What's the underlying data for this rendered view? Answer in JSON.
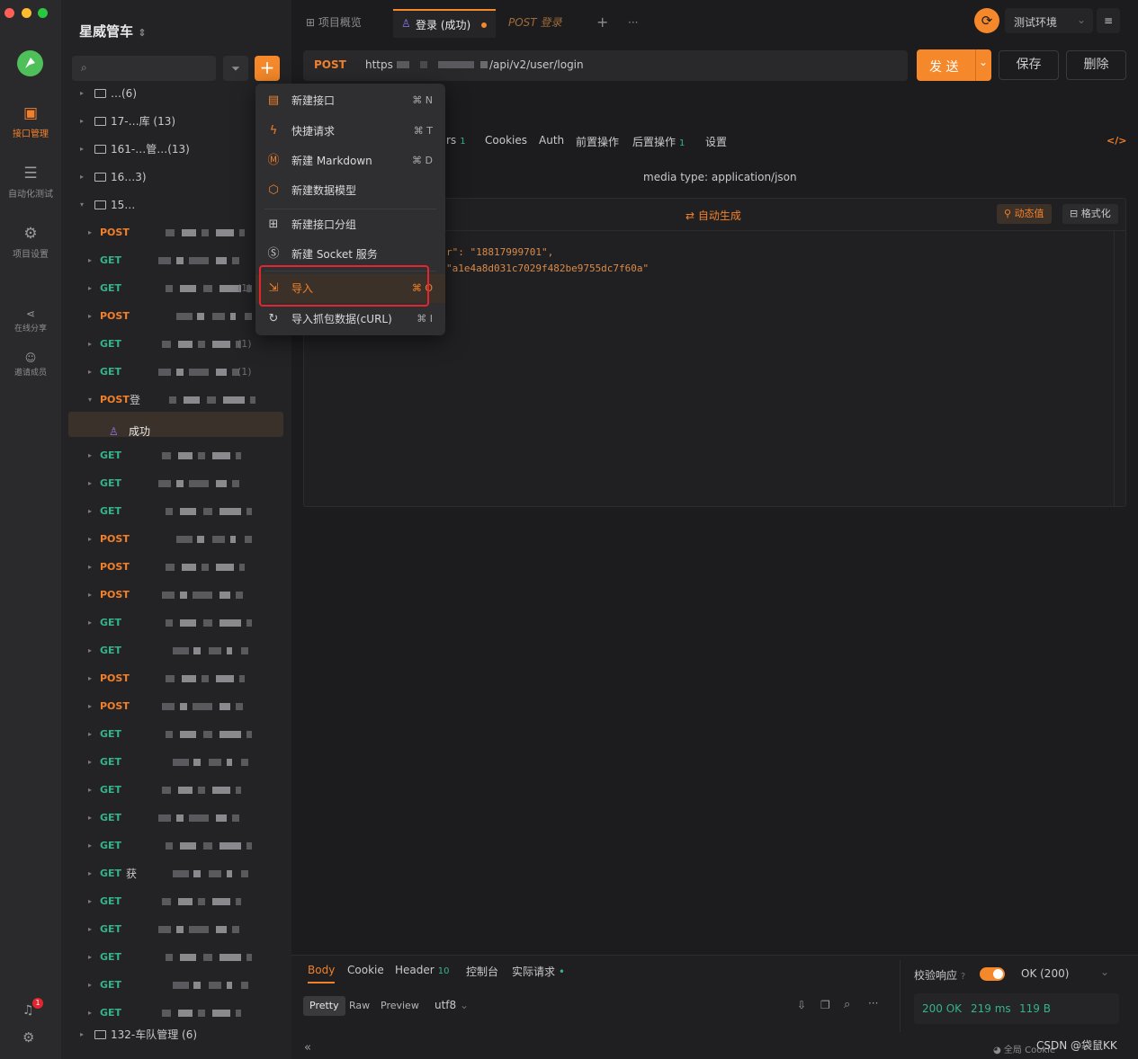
{
  "rail": {
    "items": [
      {
        "label": "接口管理",
        "icon": "api-icon"
      },
      {
        "label": "自动化测试",
        "icon": "automation-icon"
      },
      {
        "label": "项目设置",
        "icon": "settings-icon"
      },
      {
        "label": "在线分享",
        "icon": "share-icon"
      },
      {
        "label": "邀请成员",
        "icon": "invite-icon"
      }
    ],
    "notification_count": "1"
  },
  "sidebar": {
    "project_title": "星威管车",
    "tree": [
      {
        "type": "folder",
        "text": "…(6)"
      },
      {
        "type": "folder",
        "text": "17-…库 (13)"
      },
      {
        "type": "folder",
        "text": "161-…管…(13)"
      },
      {
        "type": "folder",
        "text": "16…3)"
      },
      {
        "type": "folder",
        "text": "15…"
      },
      {
        "type": "api",
        "method": "POST",
        "text": ""
      },
      {
        "type": "api",
        "method": "GET",
        "text": ""
      },
      {
        "type": "api",
        "method": "GET",
        "text": "(1)"
      },
      {
        "type": "api",
        "method": "POST",
        "text": ""
      },
      {
        "type": "api",
        "method": "GET",
        "text": "(1)"
      },
      {
        "type": "api",
        "method": "GET",
        "text": "(1)"
      },
      {
        "type": "api",
        "method": "POST",
        "text": "登"
      },
      {
        "type": "case",
        "text": "成功"
      },
      {
        "type": "api",
        "method": "GET",
        "text": ""
      },
      {
        "type": "api",
        "method": "GET",
        "text": ""
      },
      {
        "type": "api",
        "method": "GET",
        "text": ""
      },
      {
        "type": "api",
        "method": "POST",
        "text": ""
      },
      {
        "type": "api",
        "method": "POST",
        "text": ""
      },
      {
        "type": "api",
        "method": "POST",
        "text": ""
      },
      {
        "type": "api",
        "method": "GET",
        "text": ""
      },
      {
        "type": "api",
        "method": "GET",
        "text": ""
      },
      {
        "type": "api",
        "method": "POST",
        "text": ""
      },
      {
        "type": "api",
        "method": "POST",
        "text": ""
      },
      {
        "type": "api",
        "method": "GET",
        "text": ""
      },
      {
        "type": "api",
        "method": "GET",
        "text": ""
      },
      {
        "type": "api",
        "method": "GET",
        "text": ""
      },
      {
        "type": "api",
        "method": "GET",
        "text": ""
      },
      {
        "type": "api",
        "method": "GET",
        "text": ""
      },
      {
        "type": "api",
        "method": "GET",
        "text": "获"
      },
      {
        "type": "api",
        "method": "GET",
        "text": ""
      },
      {
        "type": "api",
        "method": "GET",
        "text": ""
      },
      {
        "type": "api",
        "method": "GET",
        "text": ""
      },
      {
        "type": "api",
        "method": "GET",
        "text": ""
      },
      {
        "type": "api",
        "method": "GET",
        "text": ""
      },
      {
        "type": "folder",
        "text": "132-车队管理 (6)"
      }
    ]
  },
  "menu": {
    "items": [
      {
        "label": "新建接口",
        "shortcut": "⌘ N",
        "icon": "new-api-icon"
      },
      {
        "label": "快捷请求",
        "shortcut": "⌘ T",
        "icon": "lightning-icon"
      },
      {
        "label": "新建 Markdown",
        "shortcut": "⌘ D",
        "icon": "markdown-icon"
      },
      {
        "label": "新建数据模型",
        "shortcut": "",
        "icon": "cube-icon"
      },
      {
        "label": "新建接口分组",
        "shortcut": "",
        "icon": "folder-plus-icon"
      },
      {
        "label": "新建 Socket 服务",
        "shortcut": "",
        "icon": "socket-icon"
      },
      {
        "label": "导入",
        "shortcut": "⌘ O",
        "icon": "import-icon"
      },
      {
        "label": "导入抓包数据(cURL)",
        "shortcut": "⌘ I",
        "icon": "curl-icon"
      }
    ]
  },
  "tabs": [
    {
      "label": "项目概览"
    },
    {
      "label": "登录 (成功)"
    },
    {
      "label": "POST 登录"
    }
  ],
  "env": {
    "label": "测试环境"
  },
  "request": {
    "method": "POST",
    "url_prefix": "https",
    "url_suffix": "/api/v2/user/login",
    "send": "发 送",
    "save": "保存",
    "delete": "删除"
  },
  "subtabs": {
    "params_tail": "rs",
    "params_count": "1",
    "cookies": "Cookies",
    "auth": "Auth",
    "pre": "前置操作",
    "post": "后置操作",
    "post_count": "1",
    "settings": "设置"
  },
  "body": {
    "media_type": "media type: application/json",
    "auto_gen": "自动生成",
    "dynamic": "动态值",
    "format": "格式化",
    "line1": "r\": \"18817999701\",",
    "line2": "\"a1e4a8d031c7029f482be9755dc7f60a\""
  },
  "response": {
    "tabs": [
      "Body",
      "Cookie",
      "Header",
      "控制台",
      "实际请求"
    ],
    "header_count": "10",
    "formats": [
      "Pretty",
      "Raw",
      "Preview"
    ],
    "encoding": "utf8",
    "validate_label": "校验响应",
    "validate_option": "OK (200)",
    "status": "200 OK",
    "time": "219 ms",
    "size": "119 B",
    "footer_left": "全局 Cookie",
    "watermark": "CSDN @袋鼠KK"
  },
  "colors": {
    "accent": "#f5882a",
    "post": "#f2802b",
    "get": "#34b38a"
  }
}
